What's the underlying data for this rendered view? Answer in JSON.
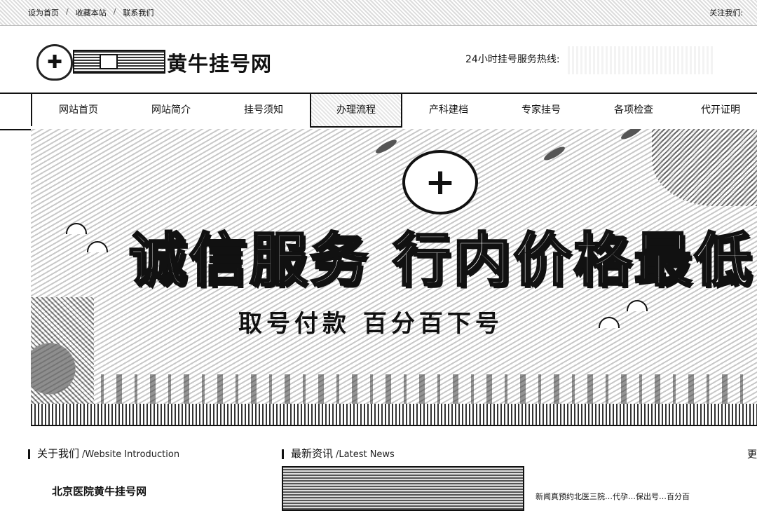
{
  "topbar": {
    "links": [
      "设为首页",
      "收藏本站",
      "联系我们"
    ],
    "separator": "/",
    "follow_label": "关注我们:"
  },
  "header": {
    "site_title": "黄牛挂号网",
    "hotline_label": "24小时挂号服务热线:"
  },
  "nav": {
    "items": [
      "网站首页",
      "网站简介",
      "挂号须知",
      "办理流程",
      "产科建档",
      "专家挂号",
      "各项检查",
      "代开证明"
    ],
    "active_index": 3
  },
  "banner": {
    "emblem": "+",
    "headline": "诚信服务 行内价格最低",
    "subline": "取号付款  百分百下号"
  },
  "sections": {
    "about": {
      "title": "关于我们",
      "subtitle": "/Website Introduction",
      "heading": "北京医院黄牛挂号网"
    },
    "news": {
      "title": "最新资讯",
      "subtitle": "/Latest News",
      "item_text": "新闻真预约北医三院…代孕…保出号…百分百"
    },
    "right_cut": "更"
  }
}
